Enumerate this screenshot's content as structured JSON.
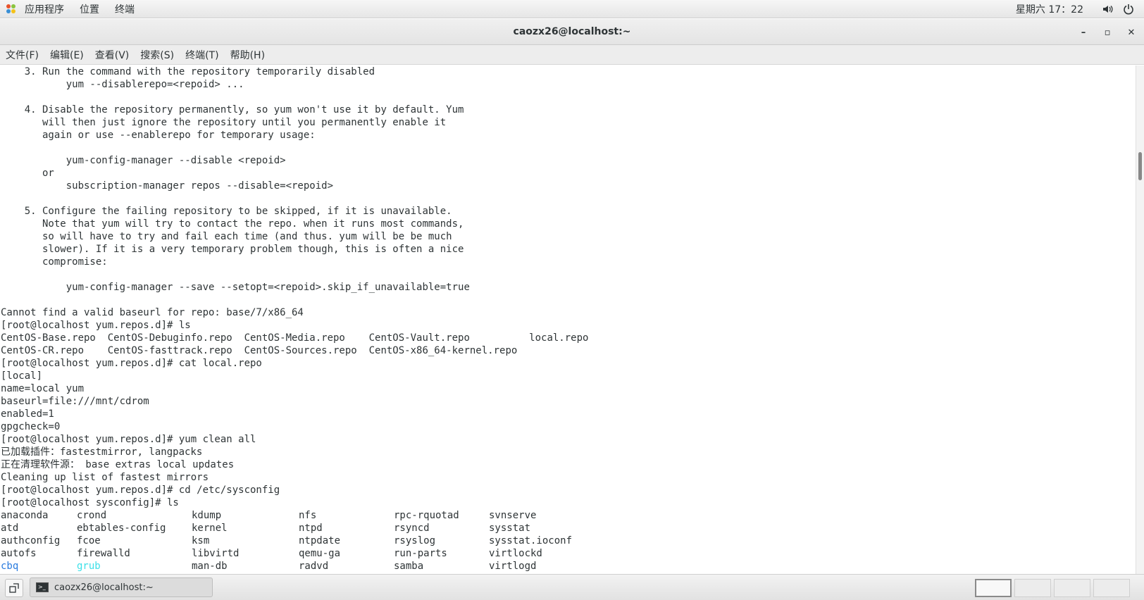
{
  "topbar": {
    "menu": [
      "应用程序",
      "位置",
      "终端"
    ],
    "clock": "星期六 17：22",
    "icons": [
      "applications-icon",
      "volume-icon",
      "power-icon"
    ]
  },
  "window": {
    "title": "caozx26@localhost:~",
    "controls": {
      "minimize": "–",
      "maximize": "▫",
      "close": "✕"
    }
  },
  "menubar": [
    "文件(F)",
    "编辑(E)",
    "查看(V)",
    "搜索(S)",
    "终端(T)",
    "帮助(H)"
  ],
  "terminal": {
    "lines": [
      "    3. Run the command with the repository temporarily disabled",
      "           yum --disablerepo=<repoid> ...",
      "",
      "    4. Disable the repository permanently, so yum won't use it by default. Yum",
      "       will then just ignore the repository until you permanently enable it",
      "       again or use --enablerepo for temporary usage:",
      "",
      "           yum-config-manager --disable <repoid>",
      "       or",
      "           subscription-manager repos --disable=<repoid>",
      "",
      "    5. Configure the failing repository to be skipped, if it is unavailable.",
      "       Note that yum will try to contact the repo. when it runs most commands,",
      "       so will have to try and fail each time (and thus. yum will be be much",
      "       slower). If it is a very temporary problem though, this is often a nice",
      "       compromise:",
      "",
      "           yum-config-manager --save --setopt=<repoid>.skip_if_unavailable=true",
      "",
      "Cannot find a valid baseurl for repo: base/7/x86_64",
      "[root@localhost yum.repos.d]# ls",
      "CentOS-Base.repo  CentOS-Debuginfo.repo  CentOS-Media.repo    CentOS-Vault.repo          local.repo",
      "CentOS-CR.repo    CentOS-fasttrack.repo  CentOS-Sources.repo  CentOS-x86_64-kernel.repo",
      "[root@localhost yum.repos.d]# cat local.repo",
      "[local]",
      "name=local yum",
      "baseurl=file:///mnt/cdrom",
      "enabled=1",
      "gpgcheck=0",
      "[root@localhost yum.repos.d]# yum clean all",
      "已加载插件：fastestmirror, langpacks",
      "正在清理软件源： base extras local updates",
      "Cleaning up list of fastest mirrors",
      "[root@localhost yum.repos.d]# cd /etc/sysconfig",
      "[root@localhost sysconfig]# ls"
    ],
    "ls_rows": [
      [
        {
          "t": "anaconda"
        },
        {
          "t": "crond"
        },
        {
          "t": "kdump"
        },
        {
          "t": "nfs"
        },
        {
          "t": "rpc-rquotad"
        },
        {
          "t": "svnserve"
        }
      ],
      [
        {
          "t": "atd"
        },
        {
          "t": "ebtables-config"
        },
        {
          "t": "kernel"
        },
        {
          "t": "ntpd"
        },
        {
          "t": "rsyncd"
        },
        {
          "t": "sysstat"
        }
      ],
      [
        {
          "t": "authconfig"
        },
        {
          "t": "fcoe"
        },
        {
          "t": "ksm"
        },
        {
          "t": "ntpdate"
        },
        {
          "t": "rsyslog"
        },
        {
          "t": "sysstat.ioconf"
        }
      ],
      [
        {
          "t": "autofs"
        },
        {
          "t": "firewalld"
        },
        {
          "t": "libvirtd"
        },
        {
          "t": "qemu-ga"
        },
        {
          "t": "run-parts"
        },
        {
          "t": "virtlockd"
        }
      ],
      [
        {
          "t": "cbq",
          "k": "dir"
        },
        {
          "t": "grub",
          "k": "exe"
        },
        {
          "t": "man-db"
        },
        {
          "t": "radvd"
        },
        {
          "t": "samba"
        },
        {
          "t": "virtlogd"
        }
      ]
    ],
    "scrollbar_position": 0.18
  },
  "taskbar": {
    "task_label": "caozx26@localhost:~",
    "workspaces": 4,
    "active_workspace": 1
  }
}
